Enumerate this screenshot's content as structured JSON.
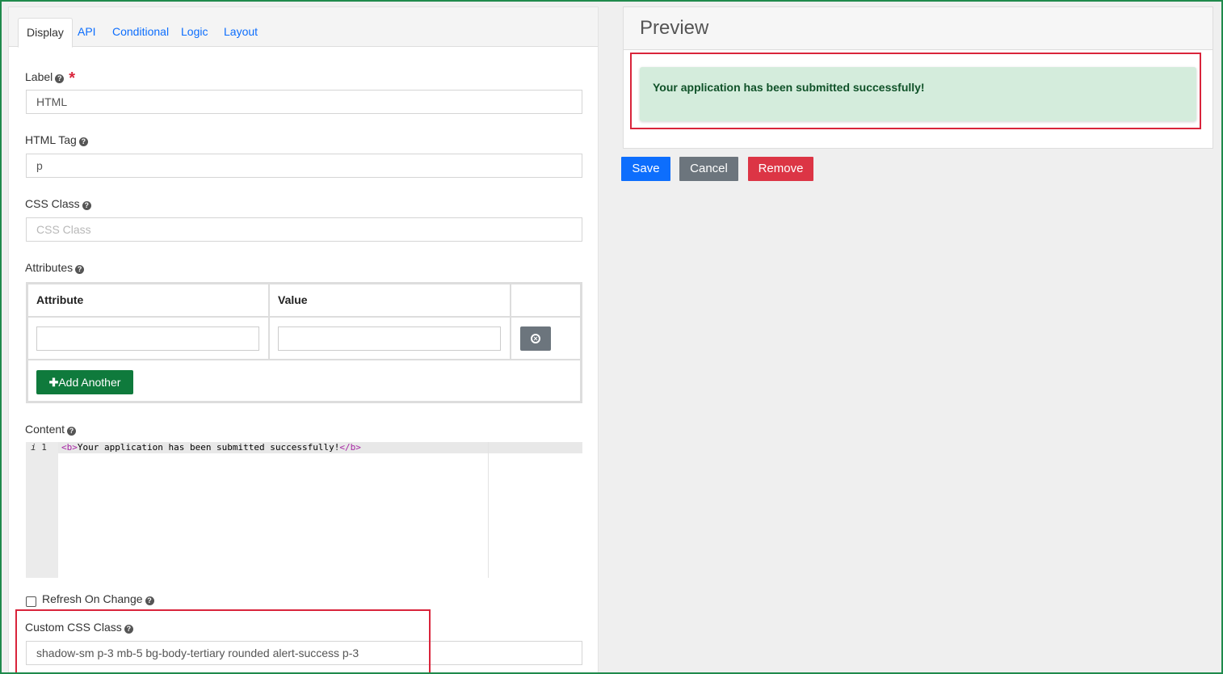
{
  "tabs": [
    {
      "label": "Display",
      "active": true
    },
    {
      "label": "API"
    },
    {
      "label": "Conditional"
    },
    {
      "label": "Logic"
    },
    {
      "label": "Layout"
    }
  ],
  "form": {
    "label": {
      "label": "Label",
      "required_mark": "*",
      "value": "HTML"
    },
    "html_tag": {
      "label": "HTML Tag",
      "value": "p"
    },
    "css_class": {
      "label": "CSS Class",
      "placeholder": "CSS Class",
      "value": ""
    },
    "attributes": {
      "label": "Attributes",
      "columns": [
        "Attribute",
        "Value"
      ],
      "add_label": "Add Another",
      "add_icon": "plus-icon",
      "remove_icon": "times-circle-icon"
    },
    "content": {
      "label": "Content",
      "line_number": "1",
      "line_marker": "i",
      "code_open_tag": "<b>",
      "code_text": "Your application has been submitted successfully!",
      "code_close_tag": "</b>"
    },
    "refresh": {
      "label": "Refresh On Change",
      "checked": false
    },
    "custom_css": {
      "label": "Custom CSS Class",
      "value": "shadow-sm p-3 mb-5 bg-body-tertiary rounded  alert-success p-3"
    },
    "help_icon": "question-circle-icon"
  },
  "preview": {
    "title": "Preview",
    "alert_text": "Your application has been submitted successfully!"
  },
  "actions": {
    "save": "Save",
    "cancel": "Cancel",
    "remove": "Remove"
  },
  "colors": {
    "primary": "#0d6efd",
    "secondary": "#6c757d",
    "danger": "#dc3545",
    "success": "#0f7a3c",
    "alert_bg": "#d4ecdc",
    "highlight": "#d9243b"
  }
}
